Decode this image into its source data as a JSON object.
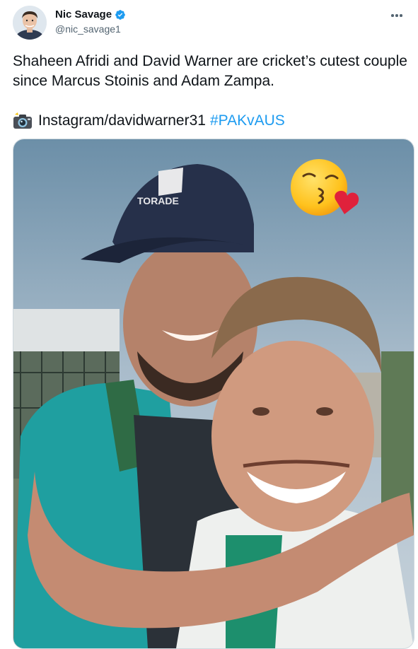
{
  "tweet": {
    "author": {
      "display_name": "Nic Savage",
      "handle": "@nic_savage1",
      "verified": true
    },
    "text_line1": "Shaheen Afridi and David Warner are cricket’s cutest couple since Marcus Stoinis and Adam Zampa.",
    "text_line2": "Instagram/davidwarner31",
    "hashtag": "#PAKvAUS",
    "media": {
      "cap_logo_text": "TORADE",
      "emoji": "kissing-face-with-heart-icon"
    }
  },
  "colors": {
    "accent": "#1d9bf0",
    "text": "#0f1419",
    "secondary": "#536471",
    "jersey_teal": "#1aa5a6",
    "cap_navy": "#26304a"
  }
}
